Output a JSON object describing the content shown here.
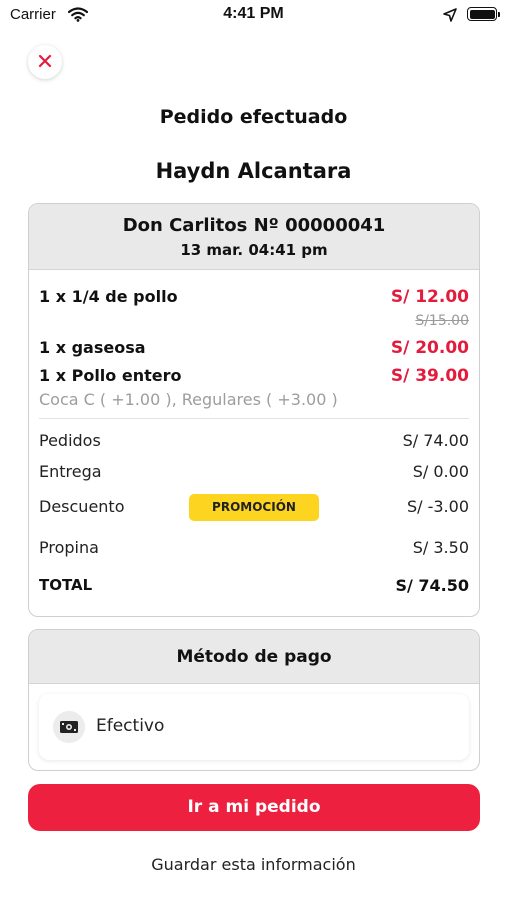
{
  "status_bar": {
    "carrier": "Carrier",
    "time": "4:41 PM",
    "icons": [
      "wifi-icon",
      "location-arrow-icon",
      "battery-icon"
    ]
  },
  "header": {
    "close_icon": "close-icon",
    "title": "Pedido efectuado",
    "customer_name": "Haydn Alcantara"
  },
  "order": {
    "store": "Don Carlitos Nº 00000041",
    "datetime": "13 mar. 04:41 pm",
    "items": [
      {
        "label": "1 x 1/4 de pollo",
        "price": "S/ 12.00",
        "original_price": "S/15.00"
      },
      {
        "label": "1 x gaseosa",
        "price": "S/ 20.00"
      },
      {
        "label": "1 x Pollo entero",
        "price": "S/ 39.00",
        "options": "Coca C ( +1.00 ), Regulares ( +3.00 )"
      }
    ],
    "summary": {
      "pedidos_label": "Pedidos",
      "pedidos_value": "S/ 74.00",
      "entrega_label": "Entrega",
      "entrega_value": "S/ 0.00",
      "descuento_label": "Descuento",
      "promo_badge": "PROMOCIÓN",
      "descuento_value": "S/ -3.00",
      "propina_label": "Propina",
      "propina_value": "S/ 3.50",
      "total_label": "TOTAL",
      "total_value": "S/ 74.50"
    }
  },
  "payment": {
    "title": "Método de pago",
    "method": "Efectivo",
    "method_icon": "cash-icon"
  },
  "actions": {
    "primary": "Ir a mi pedido",
    "secondary": "Guardar esta información"
  },
  "colors": {
    "accent": "#ee2040",
    "price": "#e31b3d",
    "promo": "#fdd520",
    "card_header": "#e9e9e9"
  }
}
